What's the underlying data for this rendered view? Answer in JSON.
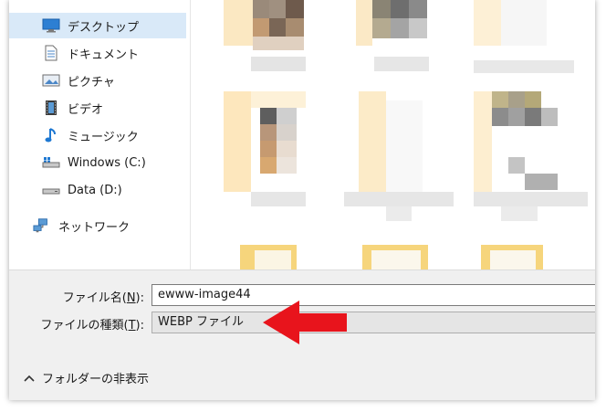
{
  "nav": {
    "items": [
      {
        "label": "デスクトップ",
        "icon": "desktop-icon",
        "selected": true
      },
      {
        "label": "ドキュメント",
        "icon": "document-icon",
        "selected": false
      },
      {
        "label": "ピクチャ",
        "icon": "pictures-icon",
        "selected": false
      },
      {
        "label": "ビデオ",
        "icon": "video-icon",
        "selected": false
      },
      {
        "label": "ミュージック",
        "icon": "music-icon",
        "selected": false
      },
      {
        "label": "Windows (C:)",
        "icon": "drive-c-icon",
        "selected": false
      },
      {
        "label": "Data (D:)",
        "icon": "drive-d-icon",
        "selected": false
      }
    ],
    "network": {
      "label": "ネットワーク",
      "icon": "network-icon"
    }
  },
  "form": {
    "filename_label_prefix": "ファイル名(",
    "filename_label_key": "N",
    "filename_label_suffix": "):",
    "filename_value": "ewww-image44",
    "filetype_label_prefix": "ファイルの種類(",
    "filetype_label_key": "T",
    "filetype_label_suffix": "):",
    "filetype_value": "WEBP ファイル"
  },
  "toggle": {
    "label": "フォルダーの非表示"
  },
  "colors": {
    "selected_bg": "#d9e9f8",
    "arrow": "#e8141c",
    "bottom_bg": "#f0f0f0"
  }
}
